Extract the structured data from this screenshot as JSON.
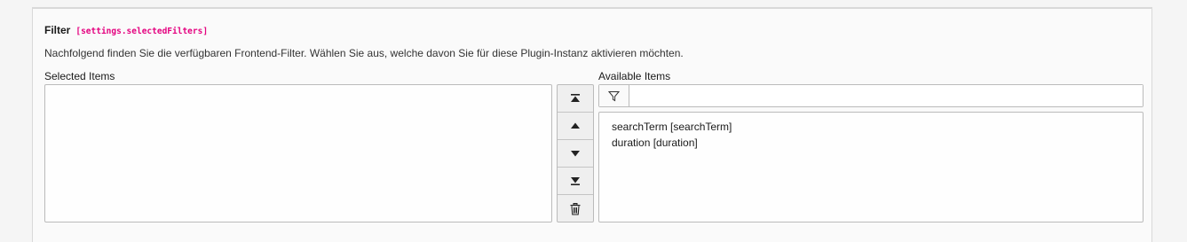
{
  "field": {
    "label": "Filter",
    "setting_key": "[settings.selectedFilters]",
    "description": "Nachfolgend finden Sie die verfügbaren Frontend-Filter. Wählen Sie aus, welche davon Sie für diese Plugin-Instanz aktivieren möchten."
  },
  "selected": {
    "label": "Selected Items",
    "items": []
  },
  "controls": {
    "buttons": [
      "move-to-top-icon",
      "move-up-icon",
      "move-down-icon",
      "move-to-bottom-icon",
      "trash-icon"
    ]
  },
  "available": {
    "label": "Available Items",
    "filter_icon": "funnel-icon",
    "filter_value": "",
    "items": [
      "searchTerm [searchTerm]",
      "duration [duration]"
    ]
  }
}
